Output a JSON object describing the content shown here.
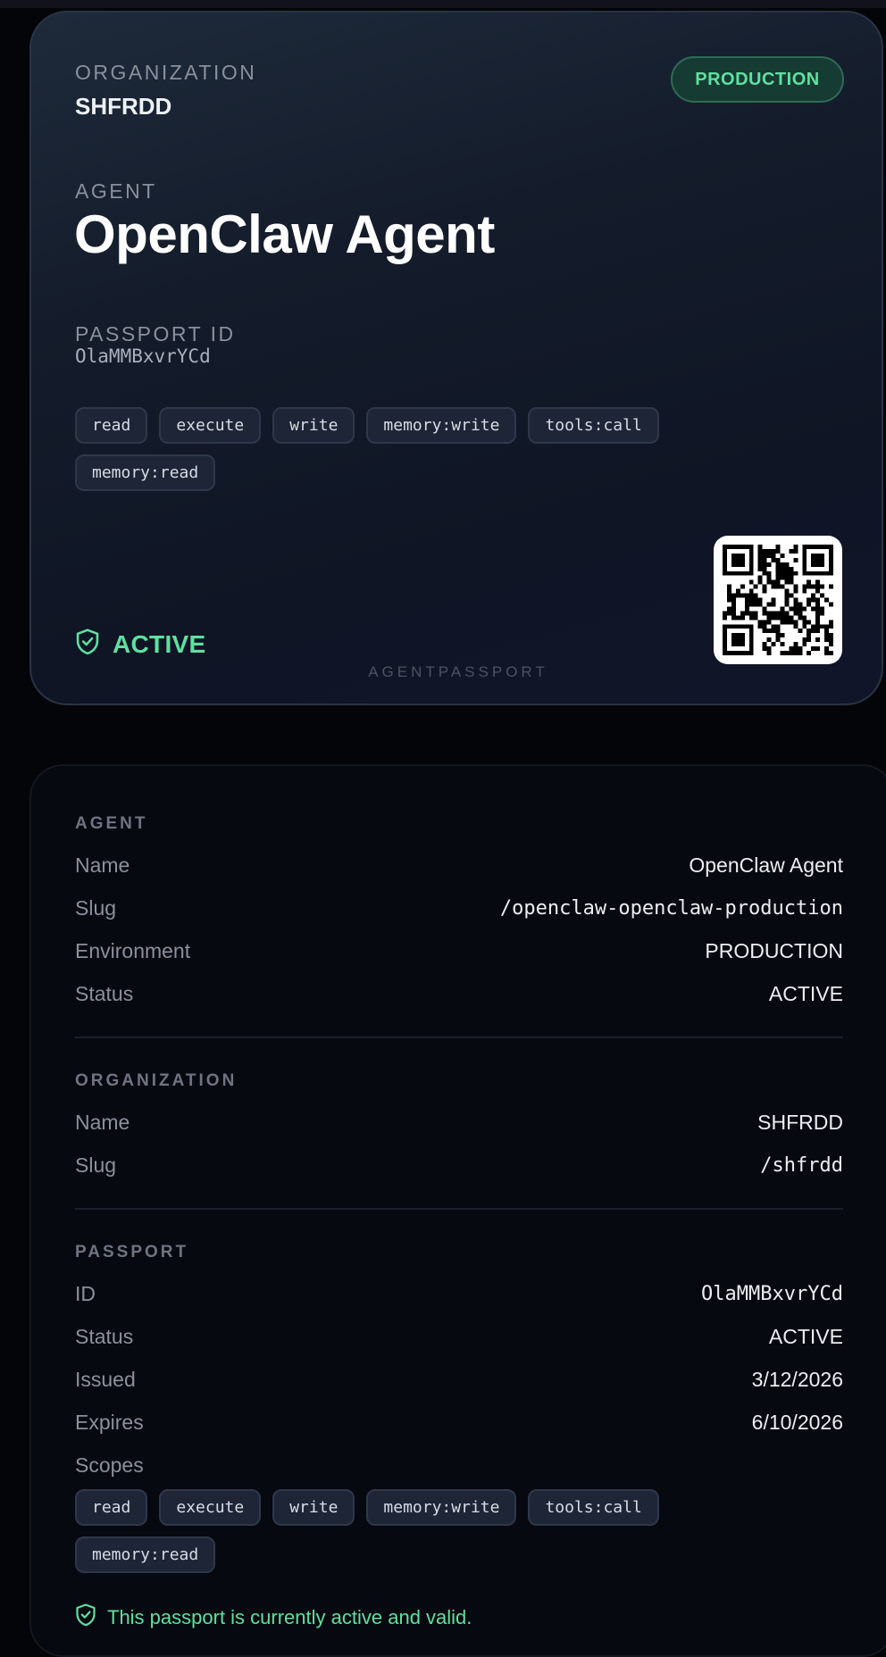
{
  "passport_card": {
    "org_label": "ORGANIZATION",
    "org_name": "SHFRDD",
    "environment_badge": "PRODUCTION",
    "agent_label": "AGENT",
    "agent_name": "OpenClaw Agent",
    "passport_id_label": "PASSPORT ID",
    "passport_id": "OlaMMBxvrYCd",
    "scopes": [
      "read",
      "execute",
      "write",
      "memory:write",
      "tools:call",
      "memory:read"
    ],
    "status": "ACTIVE",
    "brand": "AGENTPASSPORT",
    "qr_icon": "qr-code-icon",
    "status_icon": "shield-check-icon"
  },
  "details": {
    "agent_section": {
      "title": "AGENT",
      "rows": [
        {
          "key": "Name",
          "value": "OpenClaw Agent"
        },
        {
          "key": "Slug",
          "value": "/openclaw-openclaw-production"
        },
        {
          "key": "Environment",
          "value": "PRODUCTION"
        },
        {
          "key": "Status",
          "value": "ACTIVE"
        }
      ]
    },
    "organization_section": {
      "title": "ORGANIZATION",
      "rows": [
        {
          "key": "Name",
          "value": "SHFRDD"
        },
        {
          "key": "Slug",
          "value": "/shfrdd"
        }
      ]
    },
    "passport_section": {
      "title": "PASSPORT",
      "rows": [
        {
          "key": "ID",
          "value": "OlaMMBxvrYCd"
        },
        {
          "key": "Status",
          "value": "ACTIVE"
        },
        {
          "key": "Issued",
          "value": "3/12/2026"
        },
        {
          "key": "Expires",
          "value": "6/10/2026"
        }
      ],
      "scopes_label": "Scopes",
      "scopes": [
        "read",
        "execute",
        "write",
        "memory:write",
        "tools:call",
        "memory:read"
      ],
      "valid_message": "This passport is currently active and valid."
    }
  },
  "colors": {
    "accent_green": "#5fe0a0",
    "card_bg": "#141c2b",
    "page_bg": "#040508"
  }
}
